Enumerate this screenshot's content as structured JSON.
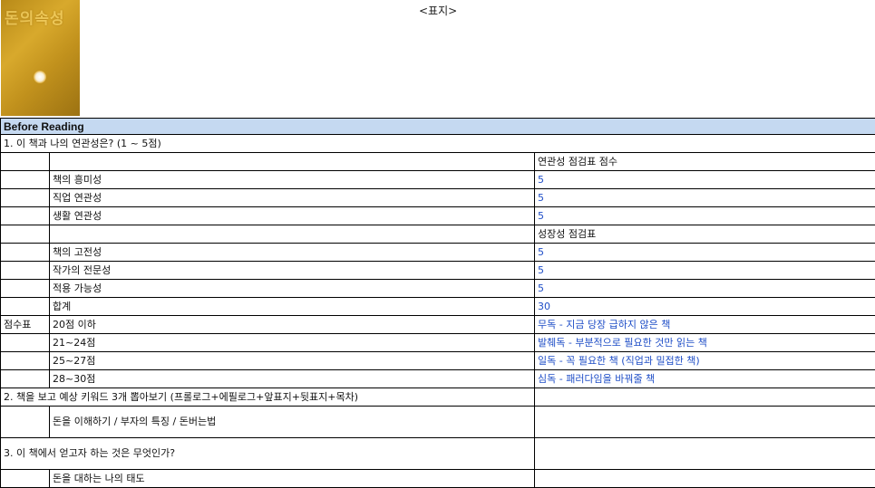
{
  "cover": {
    "image_title": "돈의속성",
    "label": "<표지>"
  },
  "section_header": "Before Reading",
  "q1": {
    "title": "1. 이 책과 나의 연관성은? (1 ~ 5점)",
    "relevance_header": "연관성 점검표 점수",
    "relevance_items": [
      {
        "label": "책의 흥미성",
        "score": "5"
      },
      {
        "label": "직업 연관성",
        "score": "5"
      },
      {
        "label": "생활 연관성",
        "score": "5"
      }
    ],
    "growth_header": "성장성 점검표",
    "growth_items": [
      {
        "label": "책의 고전성",
        "score": "5"
      },
      {
        "label": "작가의 전문성",
        "score": "5"
      },
      {
        "label": "적용 가능성",
        "score": "5"
      }
    ],
    "total_label": "합계",
    "total_value": "30",
    "score_table_label": "점수표",
    "score_table": [
      {
        "range": "20점 이하",
        "desc": "무독 - 지금 당장 급하지 않은 책"
      },
      {
        "range": "21~24점",
        "desc": "발췌독 - 부분적으로 필요한 것만 읽는 책"
      },
      {
        "range": "25~27점",
        "desc": "일독 - 꼭 필요한 책 (직업과 밀접한 책)"
      },
      {
        "range": "28~30점",
        "desc": "심독 - 패러다임을 바꿔줄 책"
      }
    ]
  },
  "q2": {
    "title": "2. 책을 보고 예상 키워드 3개 뽑아보기 (프롤로그+에필로그+앞표지+뒷표지+목차)",
    "answer": "돈을 이해하기 / 부자의 특징 / 돈버는법"
  },
  "q3": {
    "title": "3. 이 책에서 얻고자 하는 것은 무엇인가?",
    "answer": "돈을 대하는 나의 태도"
  }
}
